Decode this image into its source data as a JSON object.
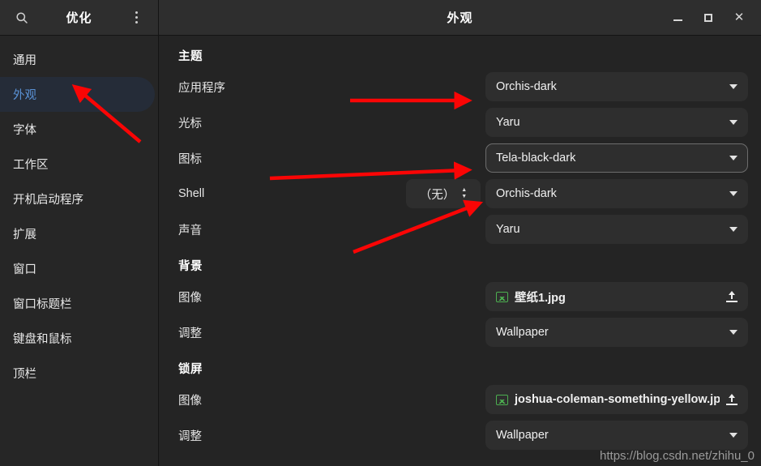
{
  "sidebar": {
    "search_icon": "search-icon",
    "title": "优化",
    "menu_icon": "menu-vertical-dots-icon",
    "items": [
      {
        "label": "通用",
        "active": false
      },
      {
        "label": "外观",
        "active": true
      },
      {
        "label": "字体",
        "active": false
      },
      {
        "label": "工作区",
        "active": false
      },
      {
        "label": "开机启动程序",
        "active": false
      },
      {
        "label": "扩展",
        "active": false
      },
      {
        "label": "窗口",
        "active": false
      },
      {
        "label": "窗口标题栏",
        "active": false
      },
      {
        "label": "键盘和鼠标",
        "active": false
      },
      {
        "label": "顶栏",
        "active": false
      }
    ]
  },
  "titlebar": {
    "title": "外观",
    "minimize_label": "最小化",
    "maximize_label": "最大化",
    "close_label": "关闭"
  },
  "sections": {
    "theme": {
      "title": "主题",
      "rows": [
        {
          "label": "应用程序",
          "value": "Orchis-dark",
          "focused": false
        },
        {
          "label": "光标",
          "value": "Yaru",
          "focused": false
        },
        {
          "label": "图标",
          "value": "Tela-black-dark",
          "focused": true
        },
        {
          "label": "Shell",
          "value": "Orchis-dark",
          "focused": false,
          "spinner": "（无）"
        },
        {
          "label": "声音",
          "value": "Yaru",
          "focused": false
        }
      ]
    },
    "background": {
      "title": "背景",
      "image_label": "图像",
      "image_value": "壁纸1.jpg",
      "adjust_label": "调整",
      "adjust_value": "Wallpaper"
    },
    "lockscreen": {
      "title": "锁屏",
      "image_label": "图像",
      "image_value": "joshua-coleman-something-yellow.jpg",
      "adjust_label": "调整",
      "adjust_value": "Wallpaper"
    }
  },
  "watermark": "https://blog.csdn.net/zhihu_0",
  "colors": {
    "accent": "#5a92d6",
    "annotation": "#fa0505",
    "panel": "#242424",
    "control": "#2e2e2e",
    "image_icon": "#4caf50"
  }
}
